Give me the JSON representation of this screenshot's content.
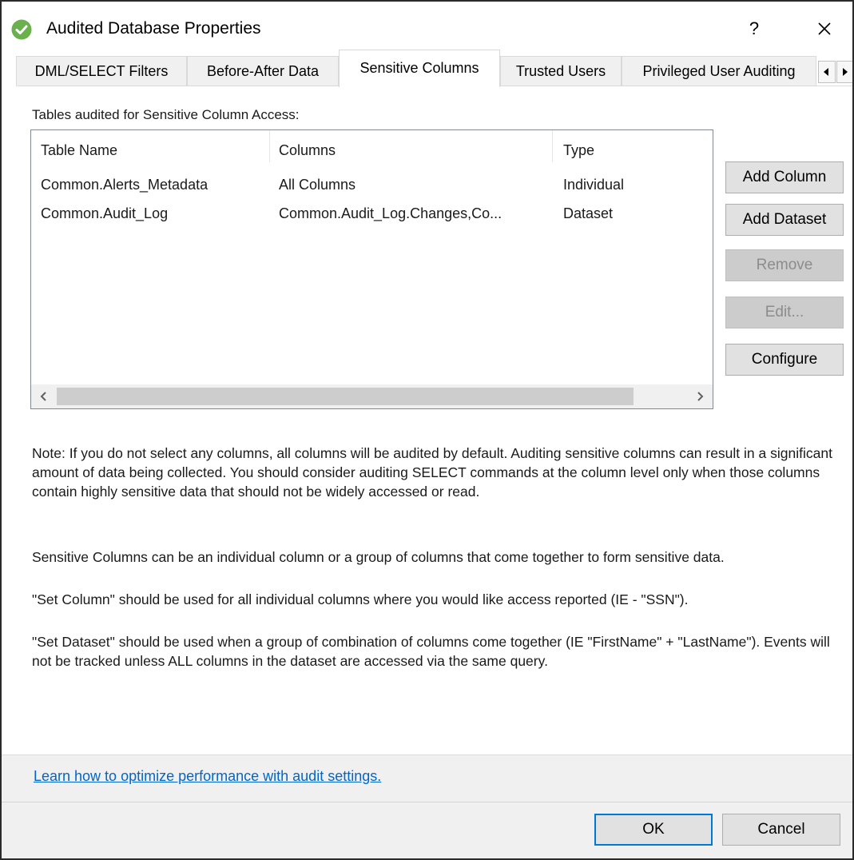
{
  "window": {
    "title": "Audited Database Properties",
    "help_label": "?",
    "accent_color": "#0078d7",
    "icon": "green-check-circle-icon"
  },
  "tabs": [
    {
      "label": "DML/SELECT Filters",
      "active": false
    },
    {
      "label": "Before-After Data",
      "active": false
    },
    {
      "label": "Sensitive Columns",
      "active": true
    },
    {
      "label": "Trusted Users",
      "active": false
    },
    {
      "label": "Privileged User Auditing",
      "active": false
    }
  ],
  "content": {
    "section_label": "Tables audited for Sensitive Column Access:",
    "table": {
      "headers": [
        "Table Name",
        "Columns",
        "Type"
      ],
      "rows": [
        [
          "Common.Alerts_Metadata",
          "All Columns",
          "Individual"
        ],
        [
          "Common.Audit_Log",
          "Common.Audit_Log.Changes,Co...",
          "Dataset"
        ]
      ]
    },
    "buttons": {
      "add_column": "Add Column",
      "add_dataset": "Add Dataset",
      "remove": "Remove",
      "edit": "Edit...",
      "configure": "Configure"
    },
    "notes": {
      "p1": "Note: If you do not select any columns, all columns will be audited by default. Auditing sensitive columns can result in a significant amount of data being collected.  You should consider auditing SELECT commands at the column level only when those columns contain highly sensitive data that should not be widely accessed or read.",
      "p2": "Sensitive Columns can be an individual column or a group of columns that come together to form sensitive data.",
      "p3": "\"Set Column\" should be used for all individual columns where you would like access reported (IE - \"SSN\").",
      "p4": "\"Set Dataset\" should be used when a group of combination of columns come together (IE \"FirstName\" + \"LastName\"). Events will not be tracked unless ALL columns in the dataset are accessed via the same query."
    }
  },
  "footer": {
    "link": "Learn how to optimize performance with audit settings.",
    "ok": "OK",
    "cancel": "Cancel"
  }
}
